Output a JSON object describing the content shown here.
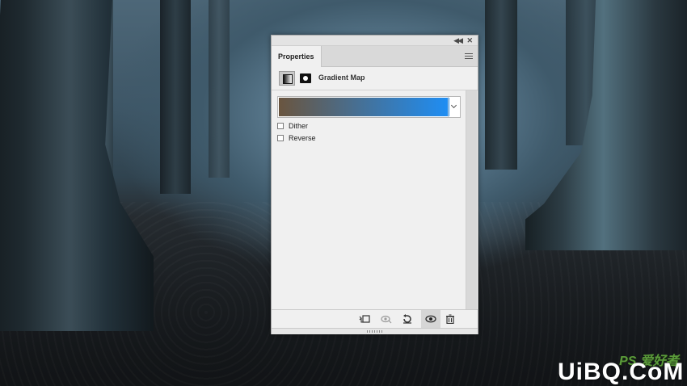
{
  "panel": {
    "tab_label": "Properties",
    "header_label": "Gradient Map",
    "gradient": {
      "start_color": "#6a553f",
      "end_color": "#1e8ef5"
    },
    "options": [
      {
        "label": "Dither",
        "checked": false
      },
      {
        "label": "Reverse",
        "checked": false
      }
    ],
    "footer_icons": [
      "clip-to-layer-icon",
      "view-previous-state-icon",
      "reset-icon",
      "visibility-eye-icon",
      "trash-icon"
    ]
  },
  "watermark": {
    "top": "PS 爱好者",
    "main": "UiBQ.CoM"
  }
}
